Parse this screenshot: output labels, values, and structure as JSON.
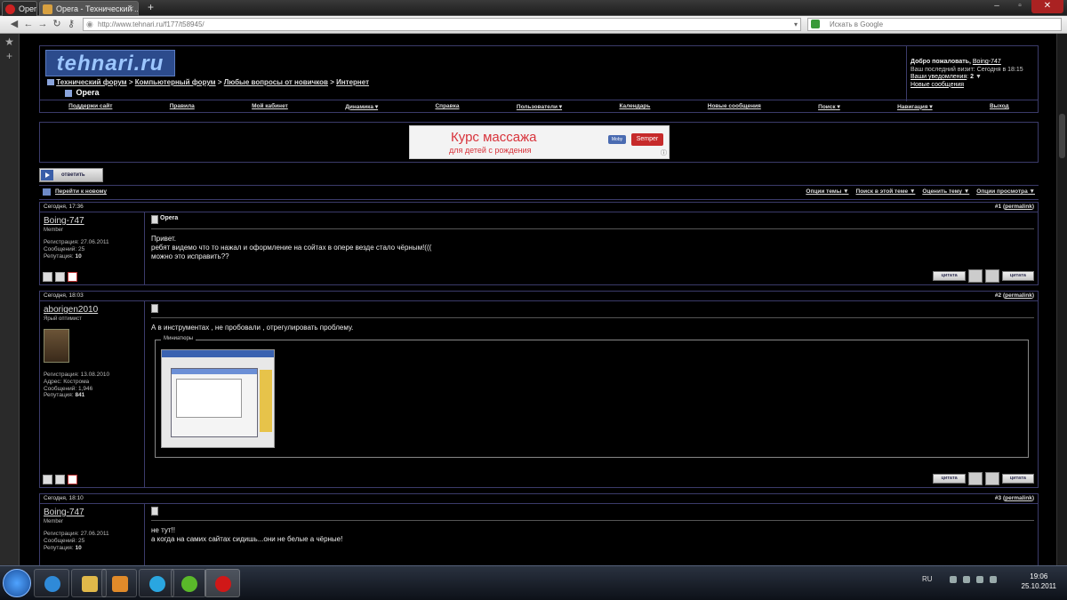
{
  "browser": {
    "tabs": [
      {
        "label": "Opera"
      },
      {
        "label": "Opera - Технический ..."
      }
    ],
    "url": "http://www.tehnari.ru/f177/t58945/",
    "search_placeholder": "Искать в Google"
  },
  "site": {
    "logo_text": "tehnari.ru",
    "breadcrumb": [
      "Технический форум",
      "Компьютерный форум",
      "Любые вопросы от новичков",
      "Интернет"
    ],
    "breadcrumb_sep": ">",
    "current_thread": "Opera",
    "welcome": {
      "line1_prefix": "Добро пожаловать,",
      "user": "Boing-747",
      "line2": "Ваш последний визит: Сегодня в 18:15",
      "notifications_label": "Ваши уведомления",
      "notifications_count": "2",
      "new_posts": "Новые сообщения"
    },
    "nav": [
      "Поддержи сайт",
      "Правила",
      "Мой кабинет",
      "Динамика",
      "Справка",
      "Пользователи",
      "Календарь",
      "Новые сообщения",
      "Поиск",
      "Навигация",
      "Выход"
    ],
    "ad": {
      "line1": "Курс массажа",
      "line2": "для детей с рождения",
      "brand": "Semper",
      "info": "ⓘ"
    },
    "reply_button": "ответить",
    "goto_new": "Перейти к новому",
    "thread_tools": [
      "Опции темы",
      "Поиск в этой теме",
      "Оценить тему",
      "Опции просмотра"
    ]
  },
  "posts": [
    {
      "date": "Сегодня, 17:36",
      "num_prefix": "#1 (",
      "permalink": "permalink",
      "num_suffix": ")",
      "user": "Boing-747",
      "user_title": "Member",
      "info": [
        "Регистрация: 27.06.2011",
        "Сообщений: 25"
      ],
      "rep_label": "Репутация:",
      "rep": "10",
      "title": "Opera",
      "text": "Привет.\nребят видемо что то нажал и оформление на сойтах в опере везде стало чёрным!(((\nможно это исправить??",
      "quote_btn": "цитата",
      "multiquote_btn": "цитата"
    },
    {
      "date": "Сегодня, 18:03",
      "num_prefix": "#2 (",
      "permalink": "permalink",
      "num_suffix": ")",
      "user": "aborigen2010",
      "user_title": "Ярый оптимист",
      "info": [
        "Регистрация: 13.08.2010",
        "Адрес: Кострома",
        "Сообщений: 1,946"
      ],
      "rep_label": "Репутация:",
      "rep": "841",
      "title": "",
      "text": "А в инструментах , не пробовали , отрегулировать проблему.",
      "thumbs_label": "Миниатюры",
      "quote_btn": "цитата",
      "multiquote_btn": "цитата"
    },
    {
      "date": "Сегодня, 18:10",
      "num_prefix": "#3 (",
      "permalink": "permalink",
      "num_suffix": ")",
      "user": "Boing-747",
      "user_title": "Member",
      "info": [
        "Регистрация: 27.06.2011",
        "Сообщений: 25"
      ],
      "rep_label": "Репутация:",
      "rep": "10",
      "title": "",
      "text": "не тут!!\nа когда на самих сайтах сидишь...они не белые а чёрные!"
    }
  ],
  "taskbar": {
    "lang": "RU",
    "time": "19:06",
    "date": "25.10.2011"
  },
  "colors": {
    "page_bg": "#000000",
    "frame_border": "#3b3b6a",
    "ad_text": "#d8333b"
  }
}
